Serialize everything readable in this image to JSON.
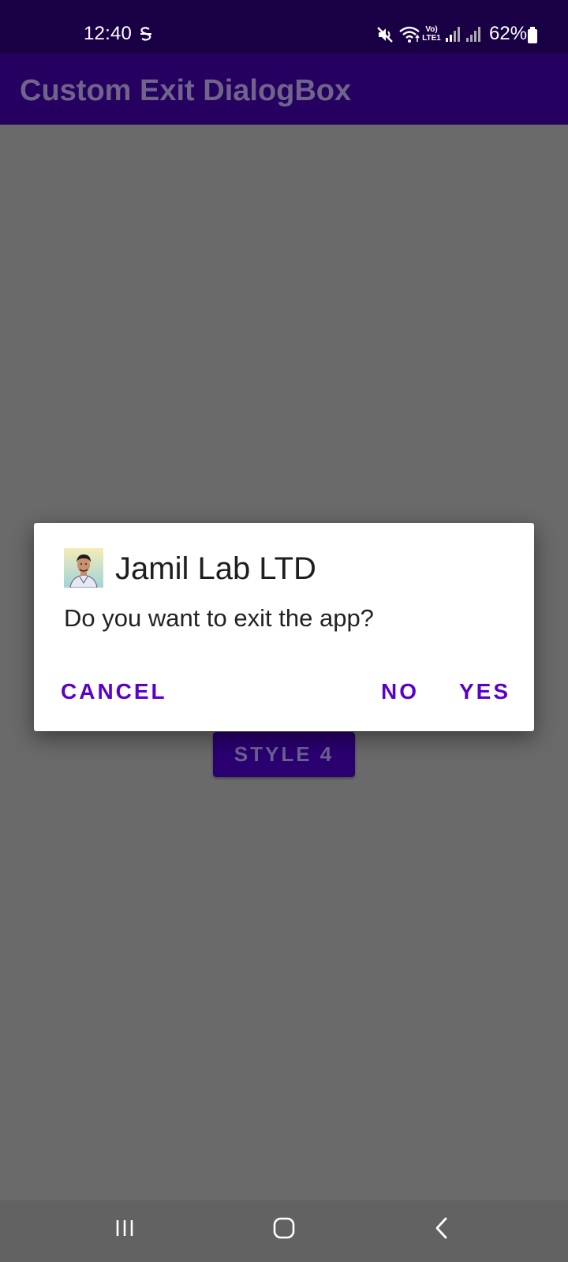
{
  "status_bar": {
    "time": "12:40",
    "battery_percent": "62%",
    "icons": [
      "s-icon",
      "mute-icon",
      "wifi-icon",
      "volte-icon",
      "signal-icon",
      "signal-icon",
      "battery-icon"
    ],
    "volte_label_top": "Vo)",
    "volte_label_bottom": "LTE1"
  },
  "app_bar": {
    "title": "Custom Exit DialogBox"
  },
  "main": {
    "style_button_label": "STYLE 4"
  },
  "dialog": {
    "avatar_icon": "profile-avatar",
    "title": "Jamil Lab LTD",
    "message": "Do you want to exit the app?",
    "buttons": {
      "cancel": "CANCEL",
      "no": "NO",
      "yes": "YES"
    }
  },
  "nav_bar": {
    "icons": [
      "recents-icon",
      "home-icon",
      "back-icon"
    ]
  },
  "colors": {
    "status_bar": "#190044",
    "app_bar": "#260060",
    "scrim": "#6a6a6a",
    "dialog_button_text": "#5a00c8",
    "dialog_background": "#ffffff"
  }
}
